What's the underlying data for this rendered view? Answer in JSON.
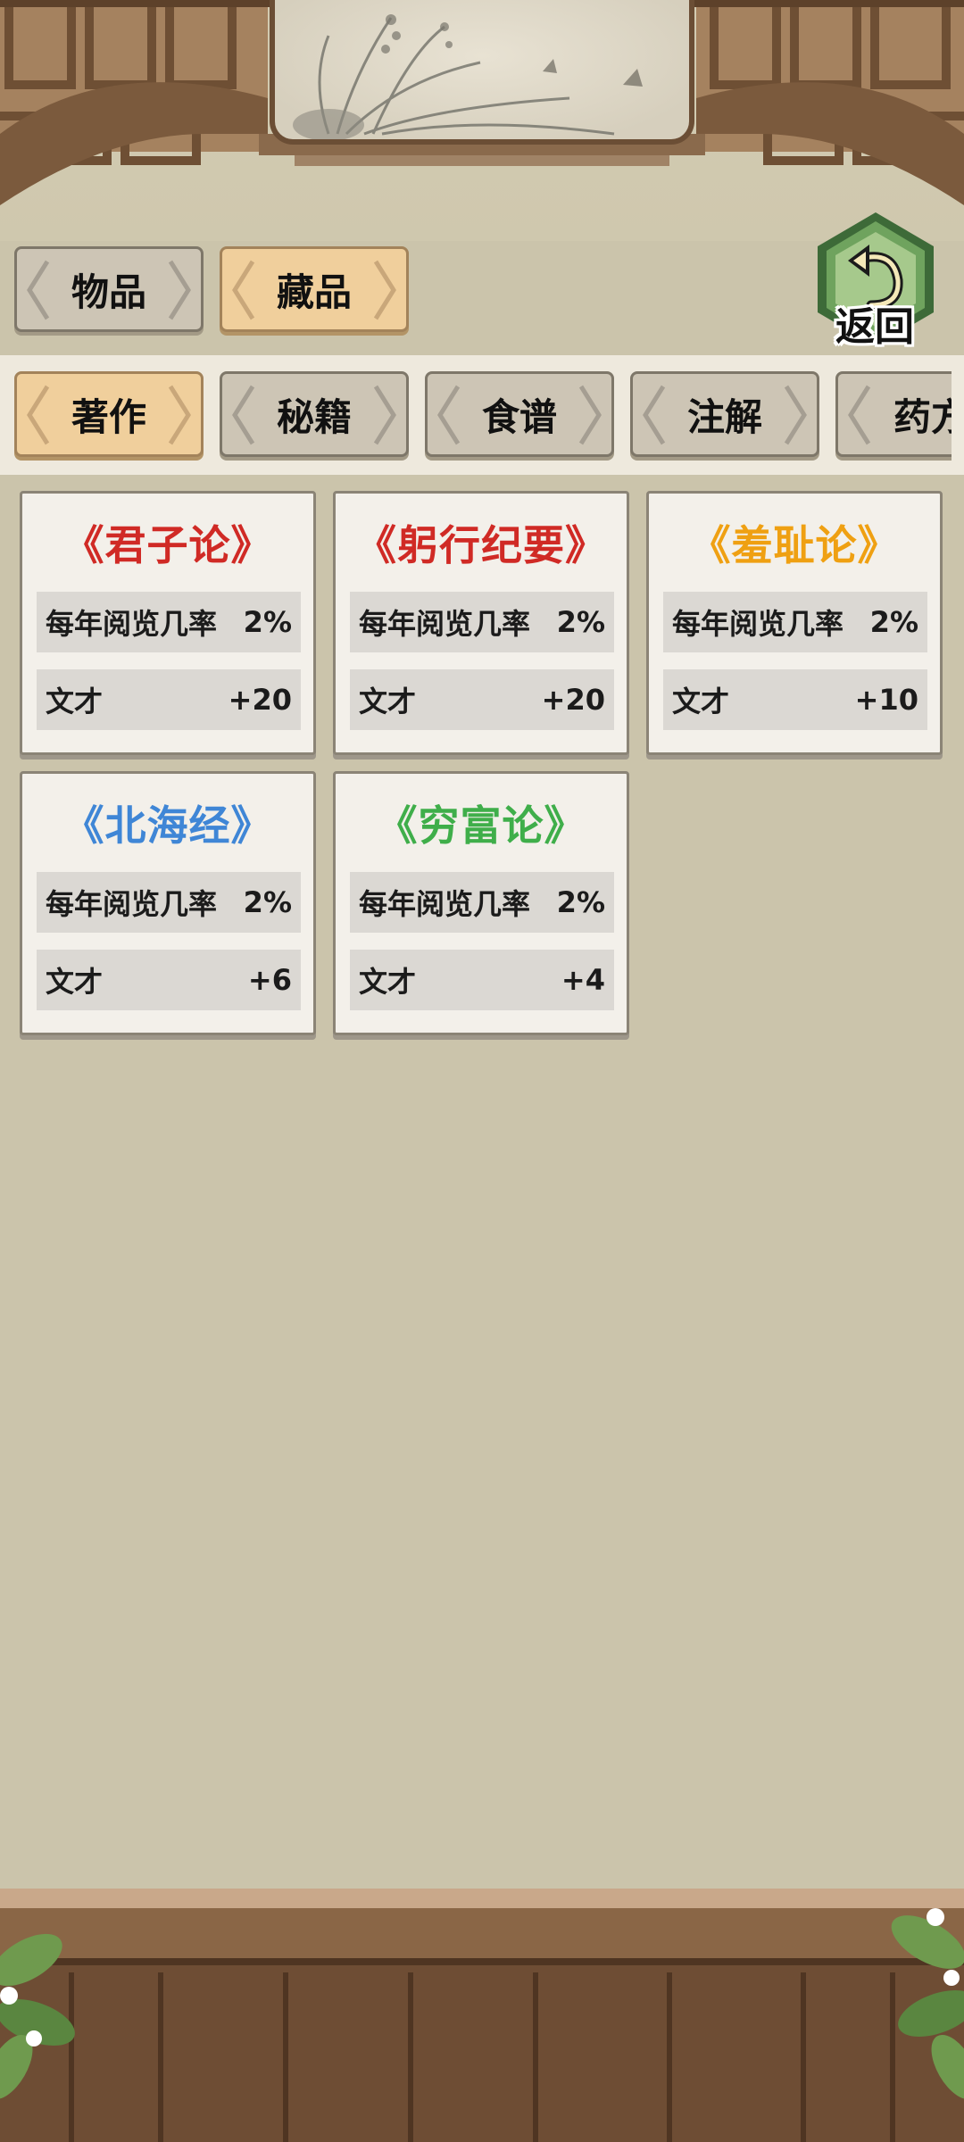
{
  "top_tabs": [
    {
      "label": "物品",
      "active": false
    },
    {
      "label": "藏品",
      "active": true
    }
  ],
  "back_button": {
    "label": "返回"
  },
  "category_tabs": [
    {
      "label": "著作",
      "active": true
    },
    {
      "label": "秘籍",
      "active": false
    },
    {
      "label": "食谱",
      "active": false
    },
    {
      "label": "注解",
      "active": false
    },
    {
      "label": "药方",
      "active": false
    }
  ],
  "books": [
    {
      "title": "《君子论》",
      "color": "#d02a25",
      "rate_label": "每年阅览几率",
      "rate_value": "2%",
      "stat_label": "文才",
      "stat_value": "+20"
    },
    {
      "title": "《躬行纪要》",
      "color": "#d02a25",
      "rate_label": "每年阅览几率",
      "rate_value": "2%",
      "stat_label": "文才",
      "stat_value": "+20"
    },
    {
      "title": "《羞耻论》",
      "color": "#efa012",
      "rate_label": "每年阅览几率",
      "rate_value": "2%",
      "stat_label": "文才",
      "stat_value": "+10"
    },
    {
      "title": "《北海经》",
      "color": "#3f86d6",
      "rate_label": "每年阅览几率",
      "rate_value": "2%",
      "stat_label": "文才",
      "stat_value": "+6"
    },
    {
      "title": "《穷富论》",
      "color": "#3fae4a",
      "rate_label": "每年阅览几率",
      "rate_value": "2%",
      "stat_label": "文才",
      "stat_value": "+4"
    }
  ]
}
